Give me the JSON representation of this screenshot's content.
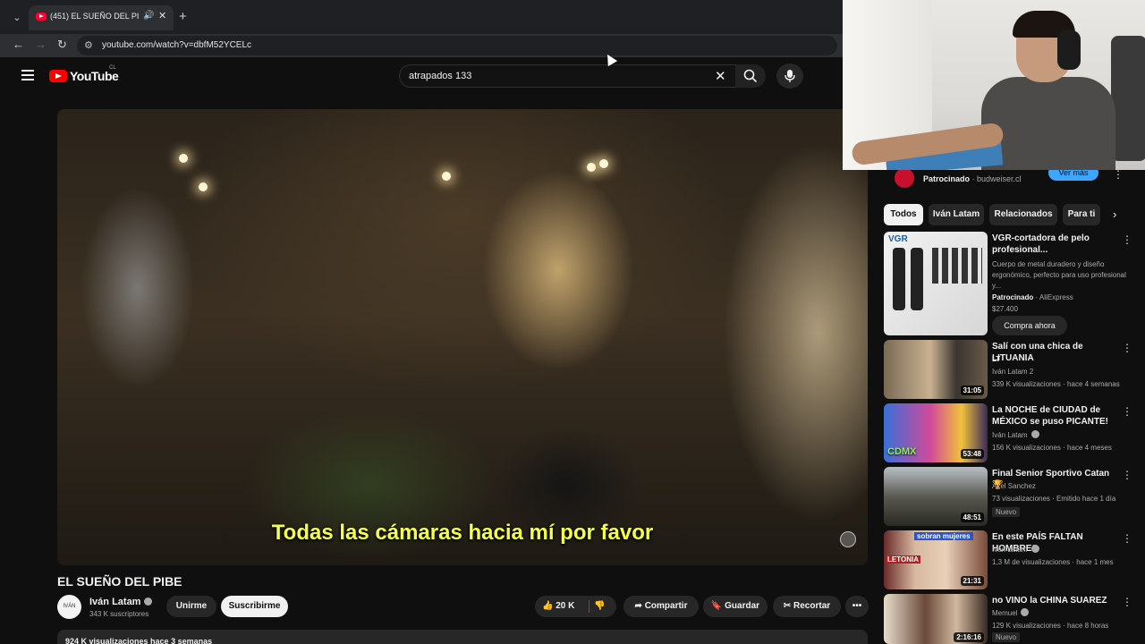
{
  "browser": {
    "tab_title": "(451) EL SUEÑO DEL PIBE -",
    "url": "youtube.com/watch?v=dbfM52YCELc"
  },
  "header": {
    "logo_text": "YouTube",
    "country_code": "CL",
    "search_query": "atrapados 133"
  },
  "video": {
    "subtitle": "Todas las cámaras hacia mí por favor",
    "title": "EL SUEÑO DEL PIBE",
    "channel": "Iván Latam",
    "channel_avatar_text": "IVÁN",
    "subscribers": "343 K suscriptores",
    "join_label": "Unirme",
    "subscribe_label": "Suscribirme",
    "likes": "20 K",
    "share_label": "Compartir",
    "save_label": "Guardar",
    "clip_label": "Recortar",
    "views_date": "924 K visualizaciones  hace 3 semanas"
  },
  "sidebar": {
    "ad": {
      "sponsored": "Patrocinado",
      "domain": "budweiser.cl",
      "cta": "Ver más"
    },
    "chips": [
      "Todos",
      "Iván Latam",
      "Relacionados",
      "Para ti"
    ],
    "items": [
      {
        "title": "VGR-cortadora de pelo profesional...",
        "desc": "Cuerpo de metal duradero y diseño ergonómico, perfecto para uso profesional y...",
        "sponsor": "Patrocinado",
        "store": "AliExpress",
        "price": "$27.400",
        "cta": "Compra ahora",
        "thumb_text": "VGR"
      },
      {
        "title": "Salí con una chica de LITUANIA",
        "flag": "LT",
        "channel": "Iván Latam 2",
        "meta": "339 K visualizaciones · hace 4 semanas",
        "duration": "31:05"
      },
      {
        "title": "La NOCHE de CIUDAD de MÉXICO se puso PICANTE!",
        "channel": "Iván Latam",
        "meta": "156 K visualizaciones · hace 4 meses",
        "duration": "53:48",
        "thumb_text": "CDMX"
      },
      {
        "title": "Final Senior Sportivo Catan 🏆",
        "channel": "Axel Sanchez",
        "meta": "73 visualizaciones · Emitido hace 1 día",
        "badge": "Nuevo",
        "duration": "48:51"
      },
      {
        "title": "En este PAÍS FALTAN HOMBRES",
        "channel": "Iván Latam",
        "meta": "1,3 M de visualizaciones · hace 1 mes",
        "duration": "21:31",
        "thumb_text": "sobran mujeres",
        "thumb_text2": "LETONIA"
      },
      {
        "title": "no VINO la CHINA SUAREZ",
        "channel": "Memuel",
        "meta": "129 K visualizaciones · hace 8 horas",
        "badge": "Nuevo",
        "duration": "2:16:16"
      }
    ]
  },
  "colors": {
    "accent": "#ff0000",
    "subtitle_yellow": "#f6ff4a",
    "bg": "#0f0f0f"
  }
}
